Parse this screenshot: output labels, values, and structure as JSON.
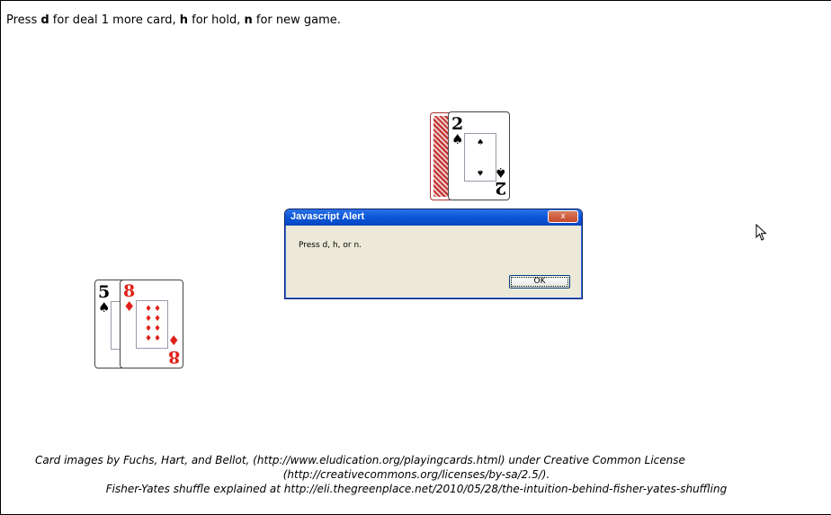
{
  "instructions": {
    "prefix": "Press ",
    "key_deal": "d",
    "text_deal": " for deal 1 more card, ",
    "key_hold": "h",
    "text_hold": " for hold, ",
    "key_new": "n",
    "text_new": " for new game."
  },
  "dealer_hand": {
    "hidden_card": "card-back",
    "card": {
      "rank": "2",
      "suit": "♠",
      "color": "#000000"
    }
  },
  "player_hand": [
    {
      "rank": "5",
      "suit": "♠",
      "color": "#000000"
    },
    {
      "rank": "8",
      "suit": "♦",
      "color": "#e0201a"
    }
  ],
  "alert": {
    "title": "Javascript Alert",
    "close_label": "x",
    "message": "Press d, h, or n.",
    "ok_label": "OK"
  },
  "footer": {
    "line1": "Card images by Fuchs, Hart, and Bellot, (http://www.eludication.org/playingcards.html) under Creative Common License",
    "line2": "(http://creativecommons.org/licenses/by-sa/2.5/).",
    "line3": "Fisher-Yates shuffle explained at http://eli.thegreenplace.net/2010/05/28/the-intuition-behind-fisher-yates-shuffling"
  },
  "icons": {
    "cursor": "mouse-pointer-icon"
  }
}
